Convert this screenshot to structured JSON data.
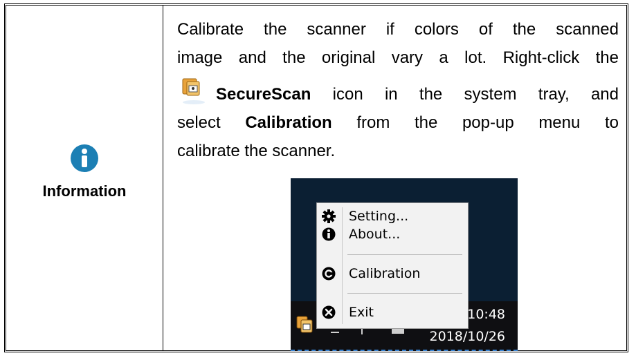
{
  "sidebar": {
    "label": "Information",
    "icon": "info-icon",
    "icon_color": "#1c7fb4"
  },
  "paragraph": {
    "line1": "Calibrate the scanner if colors of the scanned",
    "line2": "image and the original vary a lot. Right-click the",
    "line3_bold": "SecureScan",
    "line3_rest": " icon in the system tray, and",
    "line4_pre": "select ",
    "line4_bold": "Calibration",
    "line4_rest": " from the pop-up menu to",
    "line5": "calibrate the scanner."
  },
  "context_menu": {
    "items": [
      {
        "icon": "gear-icon",
        "label": "Setting..."
      },
      {
        "icon": "info-icon",
        "label": "About..."
      },
      {
        "icon": "calibration-icon",
        "label": "Calibration"
      },
      {
        "icon": "close-icon",
        "label": "Exit"
      }
    ]
  },
  "taskbar": {
    "time": "10:48",
    "date": "2018/10/26",
    "tray_icon": "securescan-tray-icon",
    "background": "#0f0f12",
    "desktop_color": "#0b1f33"
  }
}
